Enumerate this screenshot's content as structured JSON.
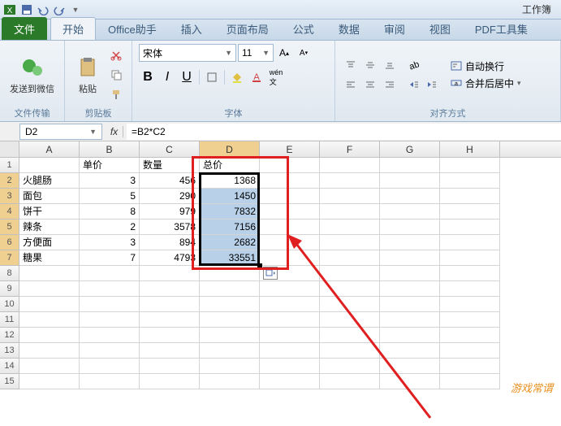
{
  "titlebar": {
    "title": "工作簿"
  },
  "tabs": {
    "file": "文件",
    "items": [
      "开始",
      "Office助手",
      "插入",
      "页面布局",
      "公式",
      "数据",
      "审阅",
      "视图",
      "PDF工具集"
    ],
    "active": 0
  },
  "ribbon": {
    "group1": {
      "label": "发送到微信"
    },
    "clipboard": {
      "label": "剪贴板",
      "paste": "粘贴"
    },
    "font": {
      "label": "字体",
      "name": "宋体",
      "size": "11",
      "bold": "B",
      "italic": "I",
      "underline": "U"
    },
    "align": {
      "label": "对齐方式",
      "wrap": "自动换行",
      "merge": "合并后居中"
    },
    "filetrans": "文件传输"
  },
  "formula": {
    "cellref": "D2",
    "fx": "fx",
    "value": "=B2*C2"
  },
  "chart_data": {
    "type": "table",
    "columns": [
      "A",
      "B",
      "C",
      "D",
      "E",
      "F",
      "G",
      "H"
    ],
    "headers_row": [
      "",
      "单价",
      "数量",
      "总价",
      "",
      "",
      "",
      ""
    ],
    "rows": [
      [
        "火腿肠",
        3,
        456,
        1368
      ],
      [
        "面包",
        5,
        290,
        1450
      ],
      [
        "饼干",
        8,
        979,
        7832
      ],
      [
        "辣条",
        2,
        3578,
        7156
      ],
      [
        "方便面",
        3,
        894,
        2682
      ],
      [
        "糖果",
        7,
        4793,
        33551
      ]
    ]
  },
  "watermark": "游戏常谓"
}
